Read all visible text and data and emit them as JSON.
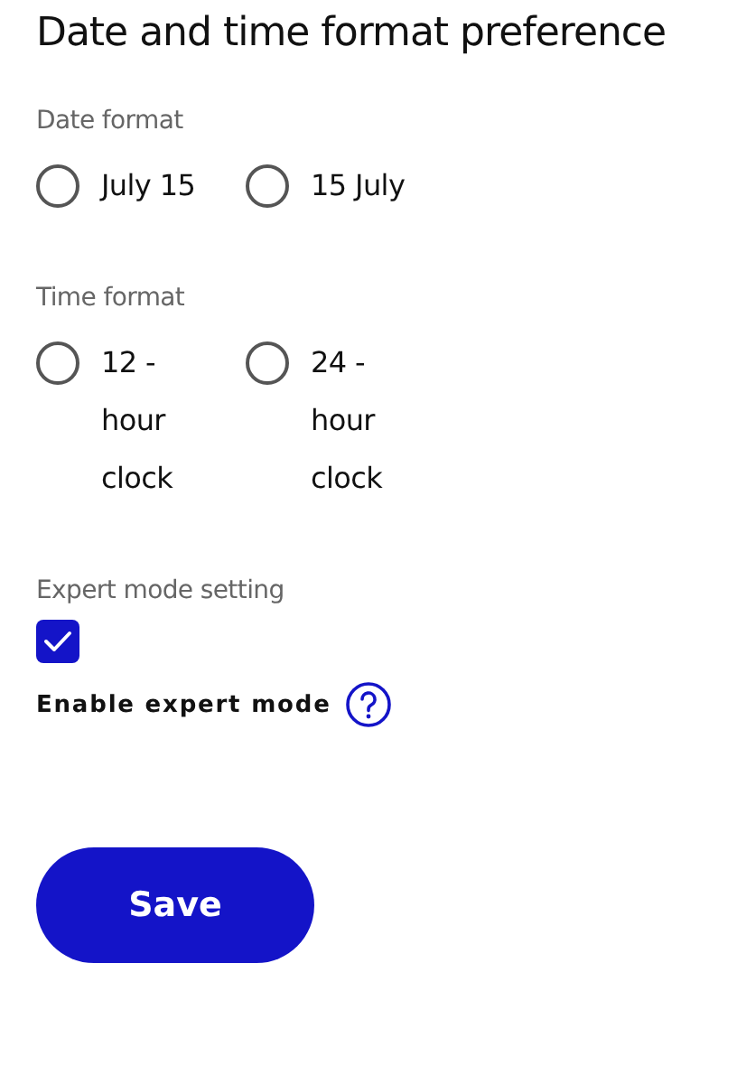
{
  "title": "Date and time format preference",
  "date_format": {
    "label": "Date format",
    "options": [
      {
        "label": "July 15",
        "selected": false
      },
      {
        "label": "15 July",
        "selected": false
      }
    ]
  },
  "time_format": {
    "label": "Time format",
    "options": [
      {
        "label": "12 - hour clock",
        "selected": false
      },
      {
        "label": "24 - hour clock",
        "selected": false
      }
    ]
  },
  "expert_mode": {
    "label": "Expert mode setting",
    "checkbox_label": "Enable expert mode",
    "checked": true
  },
  "save_button": "Save"
}
